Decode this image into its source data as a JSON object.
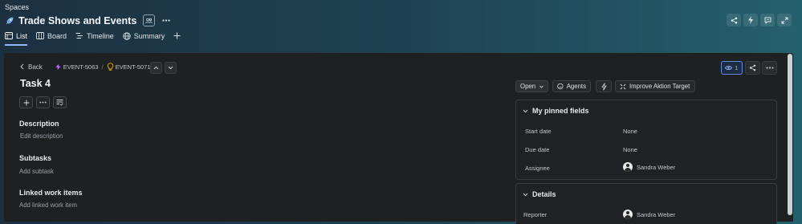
{
  "header": {
    "breadcrumb": "Spaces",
    "title": "Trade Shows and Events",
    "more_label": "···"
  },
  "tabs": [
    {
      "label": "List",
      "active": true
    },
    {
      "label": "Board"
    },
    {
      "label": "Timeline"
    },
    {
      "label": "Summary"
    }
  ],
  "issue": {
    "back_label": "Back",
    "parent_key": "EVENT-5063",
    "key": "EVENT-5071",
    "title": "Task 4",
    "watchers": "1",
    "status": "Open",
    "agents_label": "Agents",
    "improve_label": "Improve Aktion Target"
  },
  "sections": {
    "description": {
      "heading": "Description",
      "placeholder": "Edit description"
    },
    "subtasks": {
      "heading": "Subtasks",
      "placeholder": "Add subtask"
    },
    "linked": {
      "heading": "Linked work items",
      "placeholder": "Add linked work item"
    }
  },
  "pinned": {
    "heading": "My pinned fields",
    "fields": [
      {
        "label": "Start date",
        "value": "None"
      },
      {
        "label": "Due date",
        "value": "None"
      },
      {
        "label": "Assignee",
        "value": "Sandra Weber"
      }
    ]
  },
  "details": {
    "heading": "Details",
    "fields": [
      {
        "label": "Reporter",
        "value": "Sandra Weber"
      }
    ]
  },
  "colors": {
    "accent": "#8fb8ff",
    "panel": "#1f2022",
    "parent_icon": "#b86bff",
    "key_icon": "#e2b203"
  }
}
